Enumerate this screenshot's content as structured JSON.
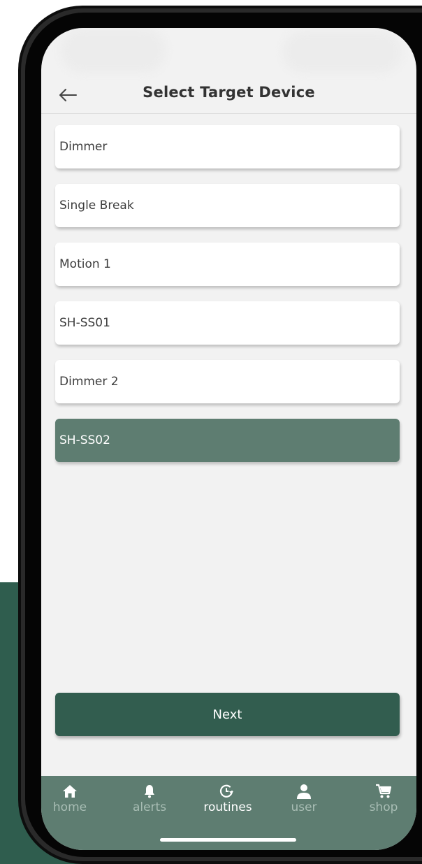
{
  "header": {
    "title": "Select Target Device",
    "back_icon": "arrow-left-icon"
  },
  "devices": [
    {
      "label": "Dimmer",
      "selected": false
    },
    {
      "label": "Single Break",
      "selected": false
    },
    {
      "label": "Motion 1",
      "selected": false
    },
    {
      "label": "SH-SS01",
      "selected": false
    },
    {
      "label": "Dimmer 2",
      "selected": false
    },
    {
      "label": "SH-SS02",
      "selected": true
    }
  ],
  "actions": {
    "next_label": "Next"
  },
  "tabbar": {
    "items": [
      {
        "label": "home",
        "icon": "home-icon",
        "active": false
      },
      {
        "label": "alerts",
        "icon": "bell-icon",
        "active": false
      },
      {
        "label": "routines",
        "icon": "clock-refresh-icon",
        "active": true
      },
      {
        "label": "user",
        "icon": "user-icon",
        "active": false
      },
      {
        "label": "shop",
        "icon": "cart-icon",
        "active": false
      }
    ]
  },
  "colors": {
    "accent": "#325d4f",
    "selected_row": "#5e7d71",
    "tabbar": "#5e7d71",
    "page_background_band": "#2f5d4e"
  }
}
